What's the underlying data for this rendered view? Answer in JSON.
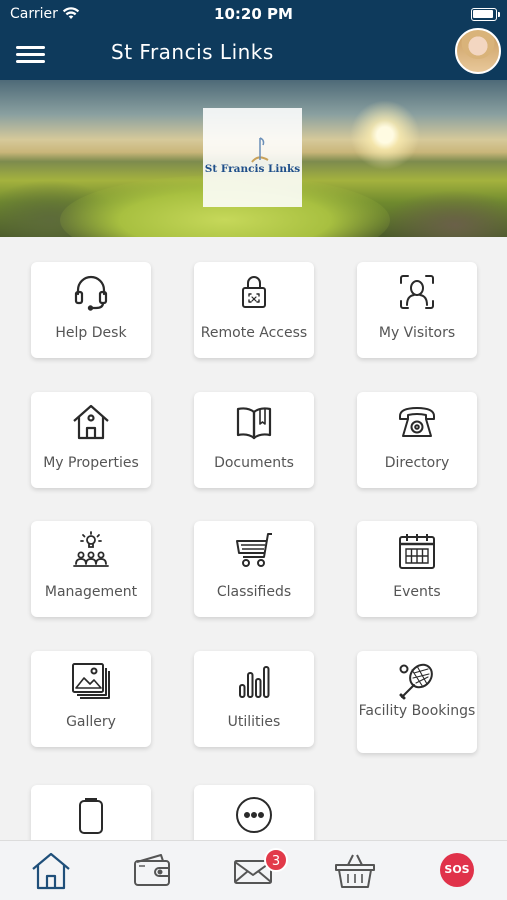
{
  "status_bar": {
    "carrier": "Carrier",
    "time": "10:20 PM"
  },
  "header": {
    "title": "St Francis Links"
  },
  "hero": {
    "logo_text": "St Francis Links"
  },
  "tiles": [
    {
      "label": "Help Desk",
      "icon": "headset-icon"
    },
    {
      "label": "Remote Access",
      "icon": "padlock-icon"
    },
    {
      "label": "My Visitors",
      "icon": "face-scan-icon"
    },
    {
      "label": "My Properties",
      "icon": "house-icon"
    },
    {
      "label": "Documents",
      "icon": "book-icon"
    },
    {
      "label": "Directory",
      "icon": "telephone-icon"
    },
    {
      "label": "Management",
      "icon": "people-idea-icon"
    },
    {
      "label": "Classifieds",
      "icon": "shopping-cart-icon"
    },
    {
      "label": "Events",
      "icon": "calendar-icon"
    },
    {
      "label": "Gallery",
      "icon": "image-gallery-icon"
    },
    {
      "label": "Utilities",
      "icon": "bar-meter-icon"
    },
    {
      "label": "Facility Bookings",
      "icon": "tennis-racket-icon"
    },
    {
      "label": "",
      "icon": "clipboard-icon"
    },
    {
      "label": "",
      "icon": "more-icon"
    }
  ],
  "tab_bar": {
    "items": [
      {
        "icon": "home-icon"
      },
      {
        "icon": "wallet-icon"
      },
      {
        "icon": "mail-icon",
        "badge": "3"
      },
      {
        "icon": "basket-icon"
      },
      {
        "icon": "sos-icon",
        "label": "SOS"
      }
    ]
  },
  "colors": {
    "header_bg": "#0e3a5c",
    "badge": "#e23a4a",
    "sos": "#e0324a",
    "tab_active": "#1f4f7a"
  }
}
